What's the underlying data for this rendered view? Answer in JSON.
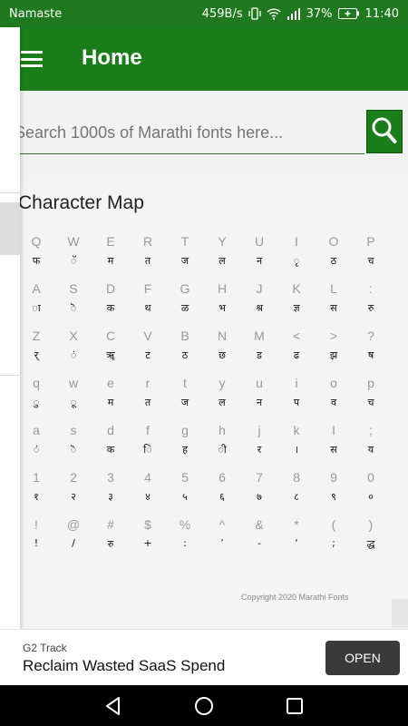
{
  "status": {
    "carrier": "Namaste",
    "speed": "459B/s",
    "battery": "37%",
    "time": "11:40"
  },
  "appbar": {
    "title": "Home"
  },
  "search": {
    "placeholder": "Search 1000s of Marathi fonts here..."
  },
  "character_map": {
    "title": "Character Map",
    "rows": [
      [
        [
          "Q",
          "फ"
        ],
        [
          "W",
          "ॅ"
        ],
        [
          "E",
          "म"
        ],
        [
          "R",
          "त"
        ],
        [
          "T",
          "ज"
        ],
        [
          "Y",
          "ल"
        ],
        [
          "U",
          "न"
        ],
        [
          "I",
          "ृ"
        ],
        [
          "O",
          "ठ"
        ],
        [
          "P",
          "च"
        ]
      ],
      [
        [
          "A",
          "ा"
        ],
        [
          "S",
          "ॆ"
        ],
        [
          "D",
          "क"
        ],
        [
          "F",
          "थ"
        ],
        [
          "G",
          "ळ"
        ],
        [
          "H",
          "भ"
        ],
        [
          "J",
          "श्र"
        ],
        [
          "K",
          "ज्ञ"
        ],
        [
          "L",
          "स"
        ],
        [
          ":",
          "रु"
        ]
      ],
      [
        [
          "Z",
          "र्"
        ],
        [
          "X",
          "ं"
        ],
        [
          "C",
          "ॠ"
        ],
        [
          "V",
          "ट"
        ],
        [
          "B",
          "ठ"
        ],
        [
          "N",
          "छ"
        ],
        [
          "M",
          "ड"
        ],
        [
          "<",
          "ढ"
        ],
        [
          ">",
          "झ"
        ],
        [
          "?",
          "ष"
        ]
      ],
      [
        [
          "q",
          "ु"
        ],
        [
          "w",
          "ू"
        ],
        [
          "e",
          "म"
        ],
        [
          "r",
          "त"
        ],
        [
          "t",
          "ज"
        ],
        [
          "y",
          "ल"
        ],
        [
          "u",
          "न"
        ],
        [
          "i",
          "प"
        ],
        [
          "o",
          "व"
        ],
        [
          "p",
          "च"
        ]
      ],
      [
        [
          "a",
          "ं"
        ],
        [
          "s",
          "ॆ"
        ],
        [
          "d",
          "क"
        ],
        [
          "f",
          "ि"
        ],
        [
          "g",
          "ह"
        ],
        [
          "h",
          "ी"
        ],
        [
          "j",
          "र"
        ],
        [
          "k",
          "।"
        ],
        [
          "l",
          "स"
        ],
        [
          ";",
          "य"
        ]
      ],
      [
        [
          "1",
          "१"
        ],
        [
          "2",
          "२"
        ],
        [
          "3",
          "३"
        ],
        [
          "4",
          "४"
        ],
        [
          "5",
          "५"
        ],
        [
          "6",
          "६"
        ],
        [
          "7",
          "७"
        ],
        [
          "8",
          "८"
        ],
        [
          "9",
          "९"
        ],
        [
          "0",
          "०"
        ]
      ],
      [
        [
          "!",
          "!"
        ],
        [
          "@",
          "/"
        ],
        [
          "#",
          "रु"
        ],
        [
          "$",
          "+"
        ],
        [
          "%",
          ":"
        ],
        [
          "^",
          "’"
        ],
        [
          "&",
          "-"
        ],
        [
          "*",
          "‘"
        ],
        [
          "(",
          ";"
        ],
        [
          ")",
          "द्ध"
        ]
      ]
    ]
  },
  "footer": {
    "copyright": "Copyright 2020 Marathi Fonts"
  },
  "ad": {
    "sponsor": "G2 Track",
    "headline": "Reclaim Wasted SaaS Spend",
    "cta": "OPEN"
  },
  "colors": {
    "primary": "#1a7f1a",
    "statusbar": "#1f7a1f"
  },
  "icons": {
    "menu": "hamburger-icon",
    "search": "magnifier-icon",
    "back": "back-triangle-icon",
    "home": "home-circle-icon",
    "recents": "recents-square-icon"
  }
}
